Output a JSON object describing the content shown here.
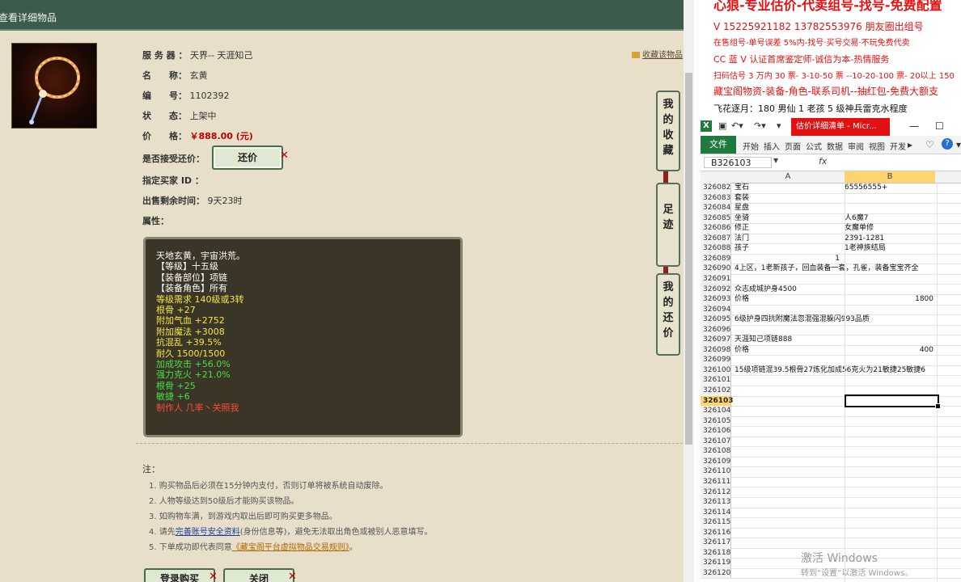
{
  "page": {
    "title": "查看详细物品",
    "favorite_link": "收藏该物品"
  },
  "item": {
    "server_label": "服 务 器 ：",
    "server": "天界-- 天涯知己",
    "name_label": "名　　称：",
    "name": "玄黄",
    "id_label": "编　　号：",
    "id": "1102392",
    "status_label": "状　　态：",
    "status": "上架中",
    "price_label": "价　　格：",
    "price": "￥888.00 (元)",
    "bargain_label": "是否接受还价：",
    "bargain_button": "还价",
    "buyer_label": "指定买家 ID ：",
    "time_label": "出售剩余时间：",
    "time": "9天23时",
    "attr_label": "属性："
  },
  "attributes": [
    {
      "text": "天地玄黄，宇宙洪荒。",
      "color": "white"
    },
    {
      "text": "【等级】十五级",
      "color": "white"
    },
    {
      "text": "【装备部位】项链",
      "color": "white"
    },
    {
      "text": "【装备角色】所有",
      "color": "white"
    },
    {
      "text": "等级需求 140级或3转",
      "color": "yellow"
    },
    {
      "text": "根骨 +27",
      "color": "yellow"
    },
    {
      "text": "附加气血 +2752",
      "color": "yellow"
    },
    {
      "text": "附加魔法 +3008",
      "color": "yellow"
    },
    {
      "text": "抗混乱 +39.5%",
      "color": "yellow"
    },
    {
      "text": "耐久 1500/1500",
      "color": "yellow"
    },
    {
      "text": "加成攻击 +56.0%",
      "color": "green"
    },
    {
      "text": "强力克火 +21.0%",
      "color": "green"
    },
    {
      "text": "根骨 +25",
      "color": "green"
    },
    {
      "text": "敏捷 +6",
      "color": "green"
    },
    {
      "text": "制作人 几率丶关照我",
      "color": "red"
    }
  ],
  "side_tabs": [
    "我的收藏",
    "足迹",
    "我的还价"
  ],
  "notes": {
    "title": "注：",
    "items": [
      {
        "pre": "1. 购买物品后必须在15分钟内支付，否则订单将被系统自动废除。",
        "link": "",
        "post": ""
      },
      {
        "pre": "2. 人物等级达到50级后才能购买该物品。",
        "link": "",
        "post": ""
      },
      {
        "pre": "3. 如购物车满，到游戏内取出后即可购买更多物品。",
        "link": "",
        "post": ""
      },
      {
        "pre": "4. 请先",
        "link": "完善账号安全资料",
        "post": "(身份信息等)，避免无法取出角色或被别人恶意填写。"
      },
      {
        "pre": "5. 下单成功即代表同意",
        "link": "《藏宝阁平台虚拟物品交易规则》",
        "post": "。"
      }
    ]
  },
  "bottom_buttons": {
    "buy": "登录购买",
    "close": "关闭"
  },
  "right_text": [
    "心狼-专业估价-代卖组号-找号-免费配置",
    "V 15225921182   13782553976 朋友圈出组号",
    "在售组号-单号误差 5%内-找号·买号交易·不玩免费代卖",
    "CC 蓝 V 认证首席鉴定师-诚信为本-热情服务",
    "扫码估号 3 万内 30 票- 3-10-50 票  --10-20-100 票- 20以上 150",
    "藏宝阁物资-装备-角色-联系司机--抽红包-免费大额支",
    "飞花逐月：180 男仙 1 老孩 5 级神兵雷克水程度"
  ],
  "excel": {
    "doc_title": "估价详细清单 - Micr...",
    "tabs": [
      "文件",
      "开始",
      "插入",
      "页面",
      "公式",
      "数据",
      "审阅",
      "视图",
      "开发"
    ],
    "name_box": "B326103",
    "fx": "fx",
    "col_a": "A",
    "col_b": "B",
    "rows": [
      {
        "n": "326082",
        "a": "宝石",
        "b": "65556555+"
      },
      {
        "n": "326083",
        "a": "套装",
        "b": ""
      },
      {
        "n": "326084",
        "a": "星盘",
        "b": ""
      },
      {
        "n": "326085",
        "a": "坐骑",
        "b": "人6魔7"
      },
      {
        "n": "326086",
        "a": "修正",
        "b": "女魔单修"
      },
      {
        "n": "326087",
        "a": "法门",
        "b": "2391-1281"
      },
      {
        "n": "326088",
        "a": "孩子",
        "b": "1老神族结局"
      },
      {
        "n": "326089",
        "a": "",
        "b": "",
        "a_right": "1"
      },
      {
        "n": "326090",
        "a": "4上区，1老新孩子，回血装备一套，孔雀，装备宝宝齐全",
        "b": ""
      },
      {
        "n": "326091",
        "a": "",
        "b": ""
      },
      {
        "n": "326092",
        "a": "众志成城护身4500",
        "b": ""
      },
      {
        "n": "326093",
        "a": "价格",
        "b": "",
        "b_right": "1800"
      },
      {
        "n": "326094",
        "a": "",
        "b": ""
      },
      {
        "n": "326095",
        "a": "6级护身四抗附魔法忽混强混躲闪993品质",
        "b": ""
      },
      {
        "n": "326096",
        "a": "",
        "b": ""
      },
      {
        "n": "326097",
        "a": "天涯知己项链888",
        "b": ""
      },
      {
        "n": "326098",
        "a": "价格",
        "b": "",
        "b_right": "400"
      },
      {
        "n": "326099",
        "a": "",
        "b": ""
      },
      {
        "n": "326100",
        "a": "15级项链混39.5根骨27炼化加成56克火为21敏捷25敏捷6",
        "b": ""
      },
      {
        "n": "326101",
        "a": "",
        "b": ""
      },
      {
        "n": "326102",
        "a": "",
        "b": ""
      },
      {
        "n": "326103",
        "a": "",
        "b": ""
      },
      {
        "n": "326104",
        "a": "",
        "b": ""
      },
      {
        "n": "326105",
        "a": "",
        "b": ""
      },
      {
        "n": "326106",
        "a": "",
        "b": ""
      },
      {
        "n": "326107",
        "a": "",
        "b": ""
      },
      {
        "n": "326108",
        "a": "",
        "b": ""
      },
      {
        "n": "326109",
        "a": "",
        "b": ""
      },
      {
        "n": "326110",
        "a": "",
        "b": ""
      },
      {
        "n": "326111",
        "a": "",
        "b": ""
      },
      {
        "n": "326112",
        "a": "",
        "b": ""
      },
      {
        "n": "326113",
        "a": "",
        "b": ""
      },
      {
        "n": "326114",
        "a": "",
        "b": ""
      },
      {
        "n": "326115",
        "a": "",
        "b": ""
      },
      {
        "n": "326116",
        "a": "",
        "b": ""
      },
      {
        "n": "326117",
        "a": "",
        "b": ""
      },
      {
        "n": "326118",
        "a": "",
        "b": ""
      },
      {
        "n": "326119",
        "a": "",
        "b": ""
      },
      {
        "n": "326120",
        "a": "",
        "b": ""
      }
    ],
    "selected_row": "326103"
  },
  "watermark": {
    "line1": "激活 Windows",
    "line2": "转到“设置”以激活 Windows。"
  }
}
